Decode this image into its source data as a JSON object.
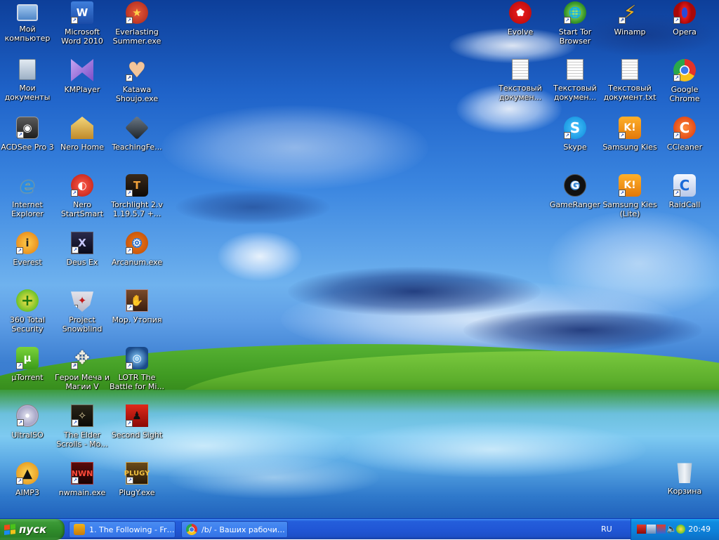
{
  "desktop": {
    "icons_left": [
      {
        "name": "my-computer",
        "label": "Мой компьютер",
        "icon": "computer-icon"
      },
      {
        "name": "microsoft-word-2010",
        "label": "Microsoft Word 2010",
        "icon": "word-icon"
      },
      {
        "name": "everlasting-summer",
        "label": "Everlasting Summer.exe",
        "icon": "star-badge-icon"
      },
      {
        "name": "my-documents",
        "label": "Мои документы",
        "icon": "documents-folder-icon"
      },
      {
        "name": "kmplayer",
        "label": "KMPlayer",
        "icon": "kmplayer-icon"
      },
      {
        "name": "katawa-shoujo",
        "label": "Katawa Shoujo.exe",
        "icon": "heart-icon"
      },
      {
        "name": "acdsee-pro-3",
        "label": "ACDSee Pro 3",
        "icon": "camera-icon"
      },
      {
        "name": "nero-home",
        "label": "Nero Home",
        "icon": "nero-home-icon"
      },
      {
        "name": "teachingfeeling",
        "label": "TeachingFe...",
        "icon": "cube-icon"
      },
      {
        "name": "internet-explorer",
        "label": "Internet Explorer",
        "icon": "ie-icon"
      },
      {
        "name": "nero-startsmart",
        "label": "Nero StartSmart",
        "icon": "nero-icon"
      },
      {
        "name": "torchlight-2",
        "label": "Torchlight 2.v 1.19.5.7 +...",
        "icon": "torchlight-icon"
      },
      {
        "name": "everest",
        "label": "Everest",
        "icon": "info-icon"
      },
      {
        "name": "deus-ex",
        "label": "Deus Ex",
        "icon": "deus-ex-icon"
      },
      {
        "name": "arcanum",
        "label": "Arcanum.exe",
        "icon": "gear-icon"
      },
      {
        "name": "360-total-security",
        "label": "360 Total Security",
        "icon": "plus-shield-icon"
      },
      {
        "name": "project-snowblind",
        "label": "Project Snowblind",
        "icon": "winged-shield-icon"
      },
      {
        "name": "mor-utopia",
        "label": "Мор. Утопия",
        "icon": "hand-icon"
      },
      {
        "name": "utorrent",
        "label": "µTorrent",
        "icon": "utorrent-icon"
      },
      {
        "name": "heroes-might-magic-v",
        "label": "Герои Меча и Магии V",
        "icon": "wings-icon"
      },
      {
        "name": "lotr-battle-middle-earth",
        "label": "LOTR The Battle for Mi...",
        "icon": "ring-icon"
      },
      {
        "name": "ultraiso",
        "label": "UltraISO",
        "icon": "disc-icon"
      },
      {
        "name": "elder-scrolls",
        "label": "The Elder Scrolls - Mo...",
        "icon": "elder-scrolls-icon"
      },
      {
        "name": "second-sight",
        "label": "Second Sight",
        "icon": "figure-icon"
      },
      {
        "name": "aimp3",
        "label": "AIMP3",
        "icon": "aimp-icon"
      },
      {
        "name": "nwmain",
        "label": "nwmain.exe",
        "icon": "nwn-icon"
      },
      {
        "name": "plugy",
        "label": "PlugY.exe",
        "icon": "plugy-icon"
      }
    ],
    "icons_right": [
      {
        "name": "evolve",
        "label": "Evolve",
        "icon": "evolve-icon"
      },
      {
        "name": "start-tor-browser",
        "label": "Start Tor Browser",
        "icon": "globe-icon"
      },
      {
        "name": "winamp",
        "label": "Winamp",
        "icon": "winamp-icon"
      },
      {
        "name": "opera",
        "label": "Opera",
        "icon": "opera-icon"
      },
      {
        "name": "text-doc-1",
        "label": "Текстовый докумен...",
        "icon": "text-file-icon"
      },
      {
        "name": "text-doc-2",
        "label": "Текстовый докумен...",
        "icon": "text-file-icon"
      },
      {
        "name": "text-doc-3",
        "label": "Текстовый документ.txt",
        "icon": "text-file-icon"
      },
      {
        "name": "google-chrome",
        "label": "Google Chrome",
        "icon": "chrome-icon"
      },
      {
        "name": "skype",
        "label": "Skype",
        "icon": "skype-icon"
      },
      {
        "name": "samsung-kies",
        "label": "Samsung Kies",
        "icon": "kies-icon"
      },
      {
        "name": "ccleaner",
        "label": "CCleaner",
        "icon": "ccleaner-icon"
      },
      {
        "name": "gameranger",
        "label": "GameRanger",
        "icon": "gameranger-icon"
      },
      {
        "name": "samsung-kies-lite",
        "label": "Samsung Kies (Lite)",
        "icon": "kies-lite-icon"
      },
      {
        "name": "raidcall",
        "label": "RaidCall",
        "icon": "raidcall-icon"
      },
      {
        "name": "recycle-bin",
        "label": "Корзина",
        "icon": "recycle-bin-icon"
      }
    ]
  },
  "taskbar": {
    "start_label": "пуск",
    "tasks": [
      {
        "label": "1. The Following - Fra...",
        "icon": "winamp-icon"
      },
      {
        "label": "/b/ - Ваших рабочих ...",
        "icon": "chrome-icon"
      }
    ],
    "language": "RU",
    "clock": "20:49"
  }
}
